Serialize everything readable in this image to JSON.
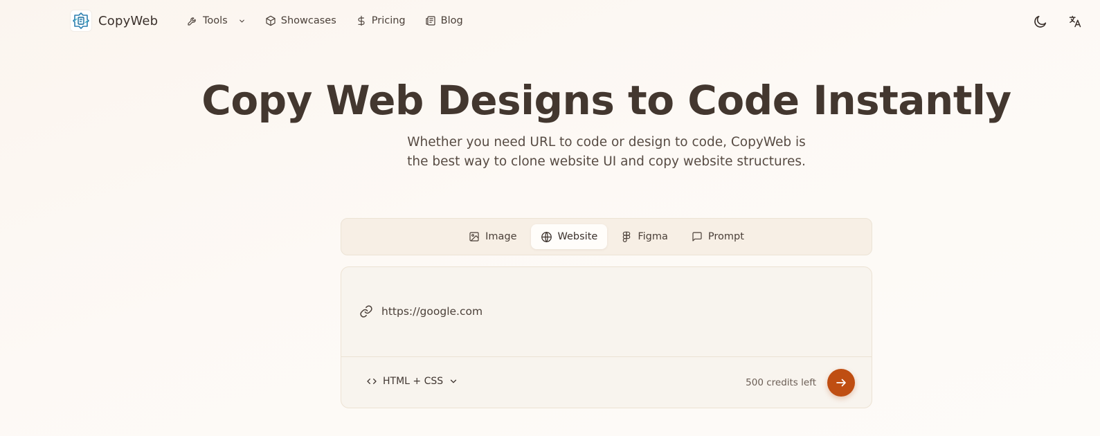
{
  "header": {
    "brand_name": "CopyWeb",
    "nav": [
      {
        "label": "Tools",
        "icon": "wrench-icon",
        "has_dropdown": true
      },
      {
        "label": "Showcases",
        "icon": "box-icon"
      },
      {
        "label": "Pricing",
        "icon": "dollar-icon"
      },
      {
        "label": "Blog",
        "icon": "newspaper-icon"
      }
    ],
    "actions": [
      "moon-icon",
      "translate-icon"
    ]
  },
  "hero": {
    "title": "Copy Web Designs to Code Instantly",
    "subtitle_line1": "Whether you need URL to code or design to code, CopyWeb is",
    "subtitle_line2": "the best way to clone website UI and copy website structures."
  },
  "mode_tabs": [
    {
      "label": "Image",
      "icon": "image-icon",
      "active": false
    },
    {
      "label": "Website",
      "icon": "globe-icon",
      "active": true
    },
    {
      "label": "Figma",
      "icon": "figma-icon",
      "active": false
    },
    {
      "label": "Prompt",
      "icon": "message-icon",
      "active": false
    }
  ],
  "input_card": {
    "url_value": "https://google.com",
    "format_label": "HTML + CSS",
    "credits_text": "500 credits left"
  },
  "colors": {
    "accent": "#bf4e12",
    "text": "#43372f",
    "tab_bg": "#f7efe5",
    "card_bg": "#f8f4ee"
  }
}
